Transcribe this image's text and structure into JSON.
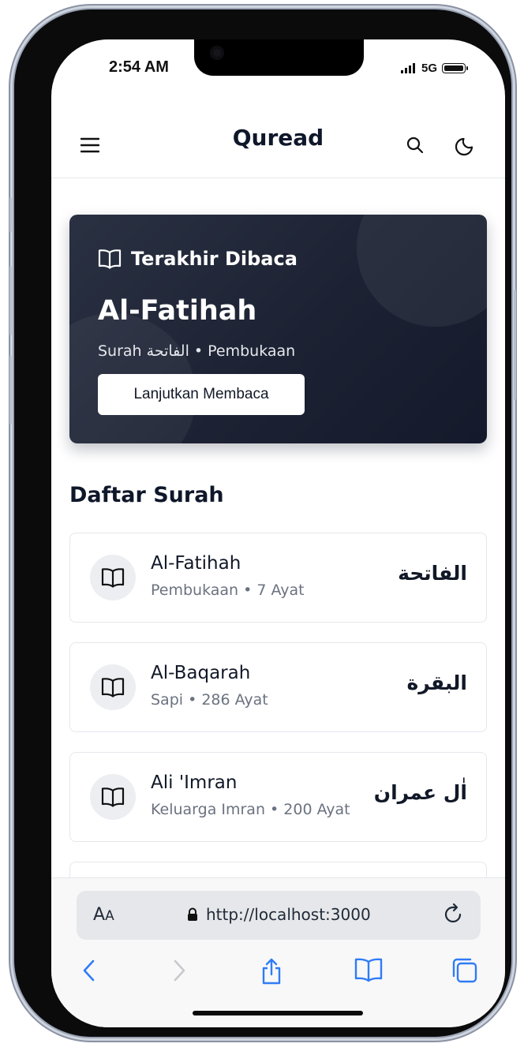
{
  "status_bar": {
    "time": "2:54 AM",
    "network": "5G"
  },
  "app": {
    "title": "Quread"
  },
  "last_read": {
    "label": "Terakhir Dibaca",
    "surah_name": "Al-Fatihah",
    "subtitle": "Surah الفاتحة • Pembukaan",
    "button_label": "Lanjutkan Membaca"
  },
  "surah_list": {
    "title": "Daftar Surah",
    "items": [
      {
        "name": "Al-Fatihah",
        "meta": "Pembukaan • 7 Ayat",
        "arabic": "الفاتحة"
      },
      {
        "name": "Al-Baqarah",
        "meta": "Sapi • 286 Ayat",
        "arabic": "البقرة"
      },
      {
        "name": "Ali 'Imran",
        "meta": "Keluarga Imran • 200 Ayat",
        "arabic": "اٰل عمران"
      }
    ]
  },
  "browser": {
    "text_size_label_big": "A",
    "text_size_label_small": "A",
    "url": "http://localhost:3000"
  }
}
